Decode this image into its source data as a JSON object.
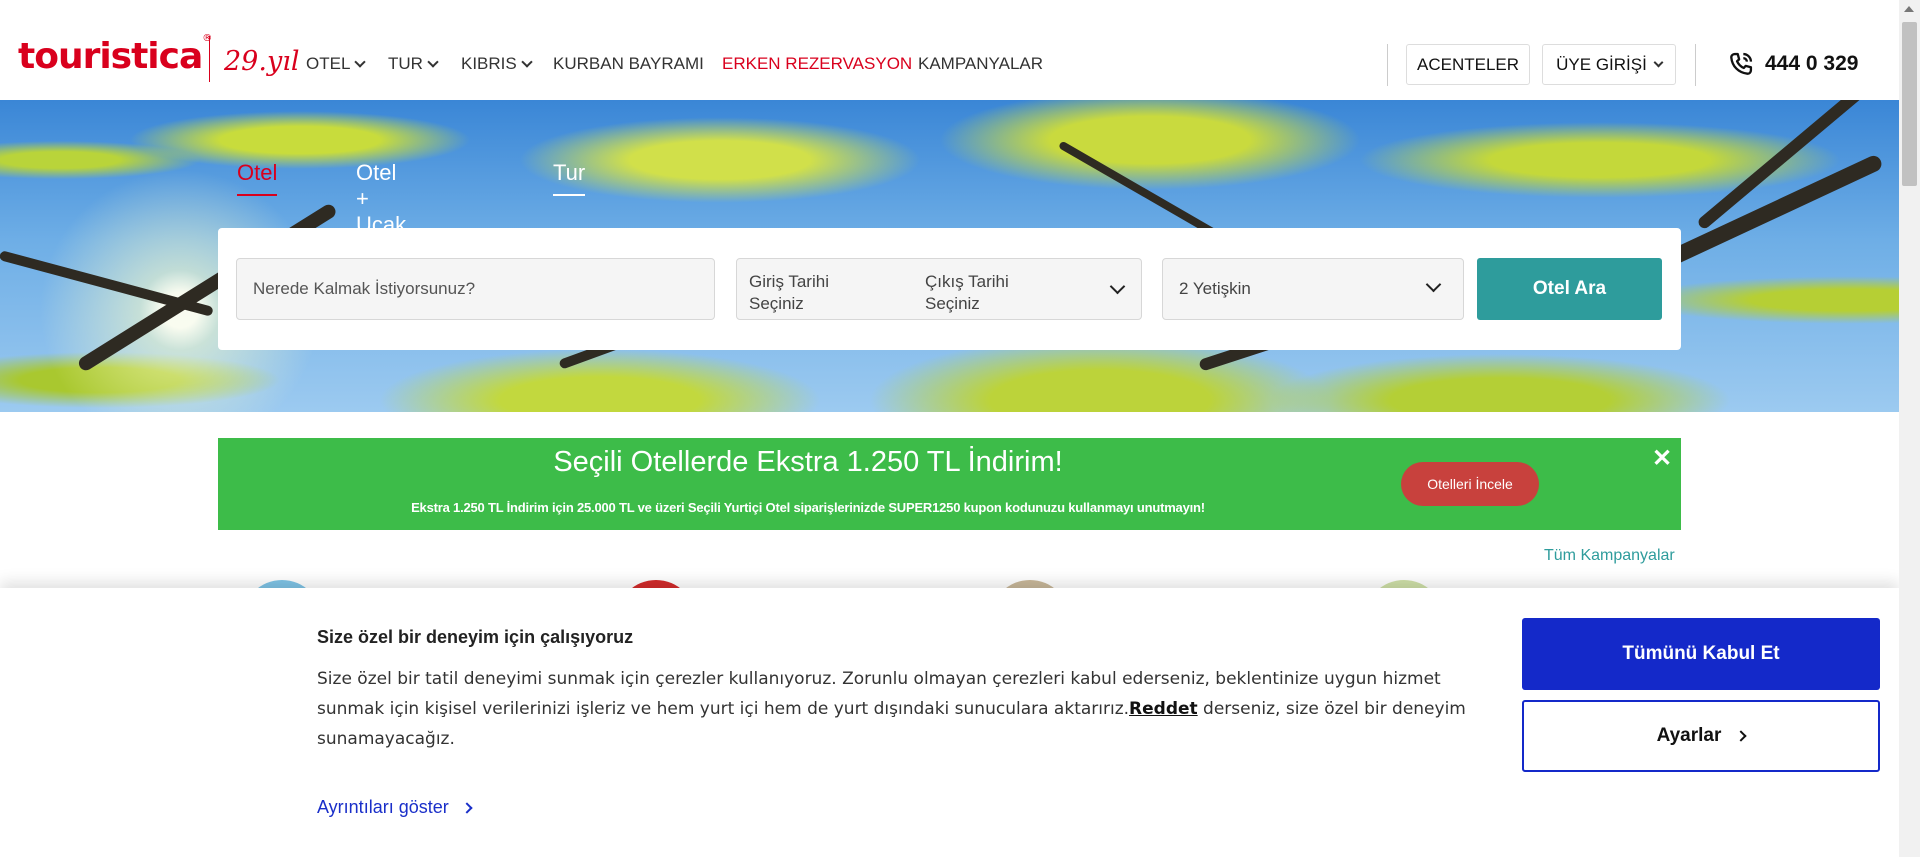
{
  "header": {
    "logo_text": "touristica",
    "logo_mark": "®",
    "logo_year": "29.yıl",
    "nav": [
      {
        "label": "OTEL",
        "dropdown": true,
        "highlight": false
      },
      {
        "label": "TUR",
        "dropdown": true,
        "highlight": false
      },
      {
        "label": "KIBRIS",
        "dropdown": true,
        "highlight": false
      },
      {
        "label": "KURBAN BAYRAMI",
        "dropdown": false,
        "highlight": false
      },
      {
        "label": "ERKEN REZERVASYON",
        "dropdown": false,
        "highlight": true
      },
      {
        "label": "KAMPANYALAR",
        "dropdown": false,
        "highlight": false
      }
    ],
    "agencies_label": "ACENTELER",
    "login_label": "ÜYE GİRİŞİ",
    "phone": "444 0 329"
  },
  "search": {
    "tabs": [
      {
        "label": "Otel",
        "active": true
      },
      {
        "label": "Otel + Uçak",
        "active": false
      },
      {
        "label": "Tur",
        "active": false
      }
    ],
    "destination_placeholder": "Nerede Kalmak İstiyorsunuz?",
    "checkin_label": "Giriş Tarihi Seçiniz",
    "checkout_label": "Çıkış Tarihi Seçiniz",
    "guests_value": "2 Yetişkin",
    "submit_label": "Otel Ara"
  },
  "promo": {
    "title": "Seçili Otellerde Ekstra 1.250 TL İndirim!",
    "subtitle_before": "Ekstra 1.250 TL İndirim için 25.000 TL ve üzeri Seçili Yurtiçi Otel siparişlerinizde ",
    "coupon_code": "SUPER1250",
    "subtitle_after": " kupon kodunuzu kullanmayı unutmayın!",
    "button_label": "Otelleri İncele",
    "close_symbol": "✕",
    "color": "#3dbc49"
  },
  "campaigns_link": "Tüm Kampanyalar",
  "cookie": {
    "title": "Size özel bir deneyim için çalışıyoruz",
    "text_before": "Size özel bir tatil deneyimi sunmak için çerezler kullanıyoruz. Zorunlu olmayan çerezleri kabul ederseniz, beklentinize uygun hizmet sunmak için kişisel verilerinizi işleriz ve hem yurt içi hem de yurt dışındaki sunuculara aktarırız.",
    "reject_link": "Reddet",
    "text_after": " derseniz, size özel bir deneyim sunamayacağız.",
    "details_link": "Ayrıntıları göster",
    "accept_label": "Tümünü Kabul Et",
    "settings_label": "Ayarlar"
  },
  "colors": {
    "brand_red": "#d9001d",
    "teal": "#2e9c9c",
    "cookie_blue": "#1429c9"
  }
}
